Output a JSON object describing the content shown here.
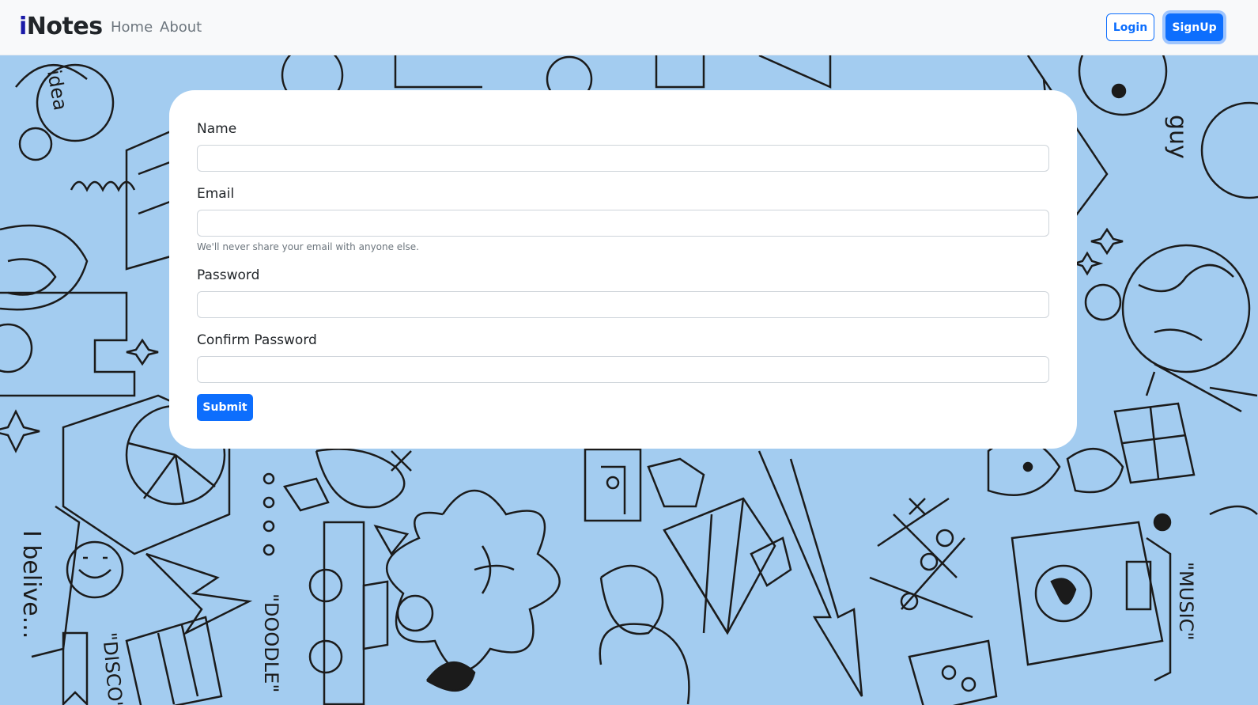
{
  "navbar": {
    "brand_prefix": "i",
    "brand_rest": "Notes",
    "links": {
      "home": "Home",
      "about": "About"
    },
    "login_label": "Login",
    "signup_label": "SignUp"
  },
  "form": {
    "name_label": "Name",
    "email_label": "Email",
    "email_help": "We'll never share your email with anyone else.",
    "password_label": "Password",
    "confirm_password_label": "Confirm Password",
    "submit_label": "Submit"
  },
  "background_doodles": {
    "words": [
      "idea",
      "guy",
      "I belive...",
      "DISCO",
      "DOODLE",
      "MUSIC"
    ]
  },
  "colors": {
    "primary": "#0d6efd",
    "background": "#a3ccf0",
    "navbar_bg": "#f8f9fa",
    "brand_i": "#1a1aa8"
  }
}
